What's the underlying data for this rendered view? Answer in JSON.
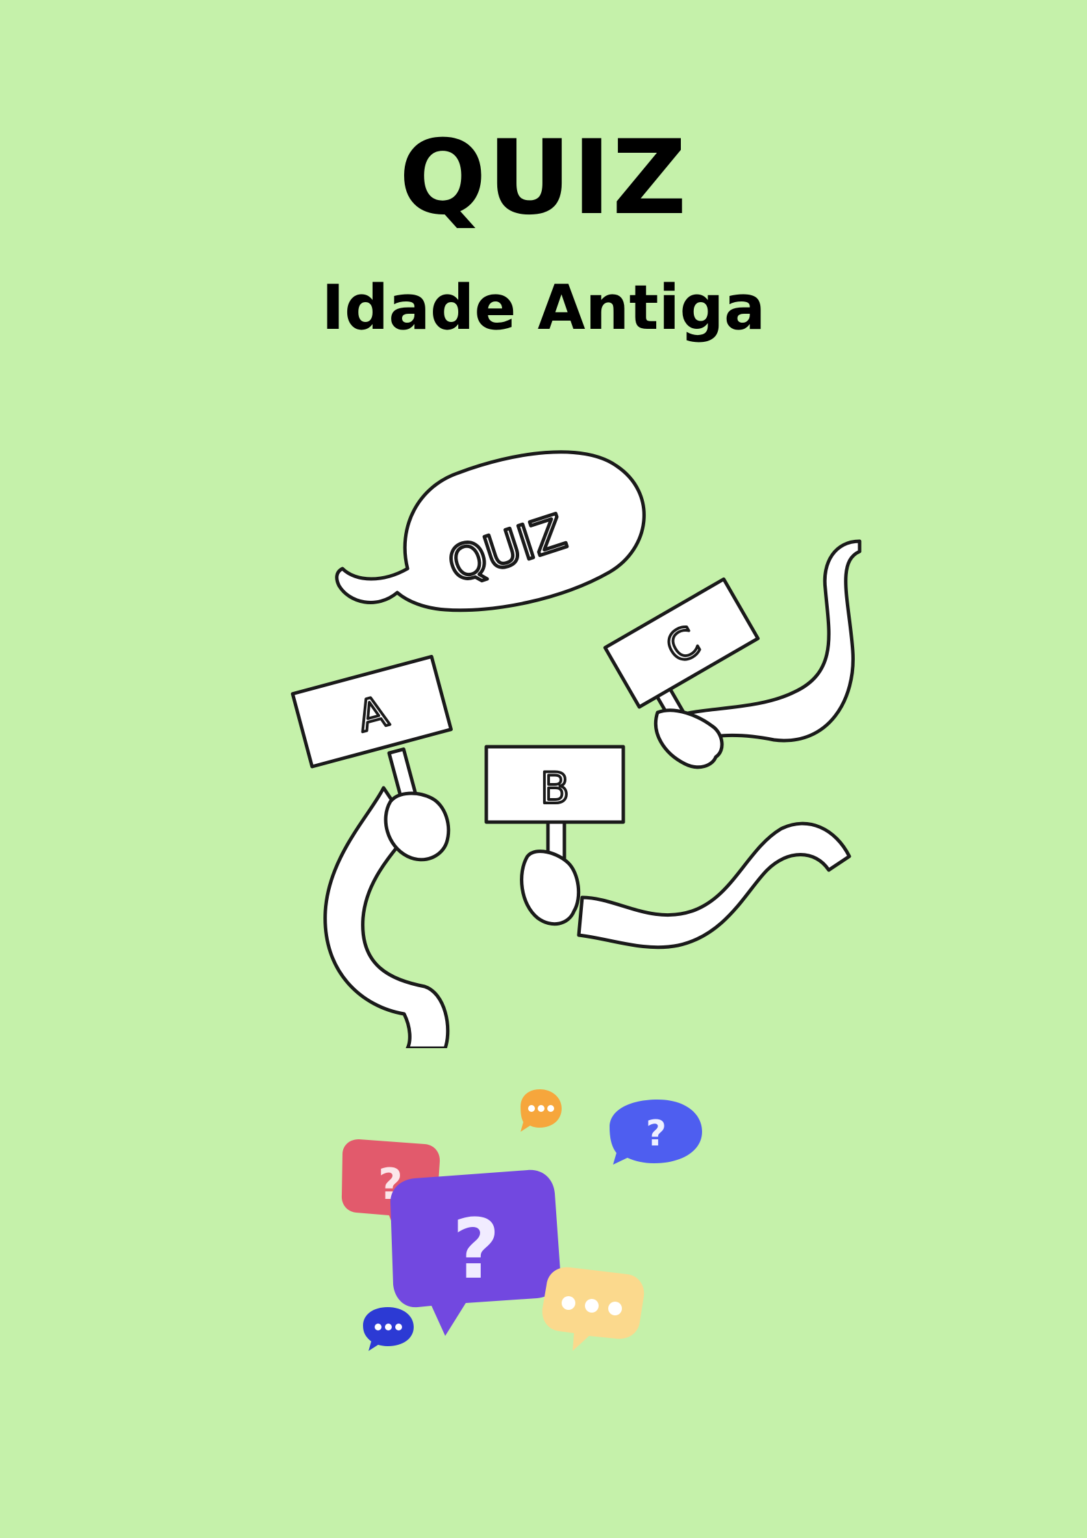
{
  "document": {
    "title": "QUIZ",
    "subtitle": "Idade Antiga"
  },
  "illustration": {
    "speech_bubble_text": "QUIZ",
    "card_labels": [
      "A",
      "B",
      "C"
    ],
    "icon": "hands-holding-answer-cards-icon"
  },
  "chat_bubbles": {
    "icon": "question-chat-bubbles-icon",
    "question_mark": "?",
    "colors": {
      "background": "#c5f1aa",
      "red": "#e25a6c",
      "purple": "#7248e0",
      "blue": "#4e5ef0",
      "orange": "#f6a63c",
      "cream": "#fbd98d",
      "dark_blue": "#2c3ad4"
    }
  }
}
